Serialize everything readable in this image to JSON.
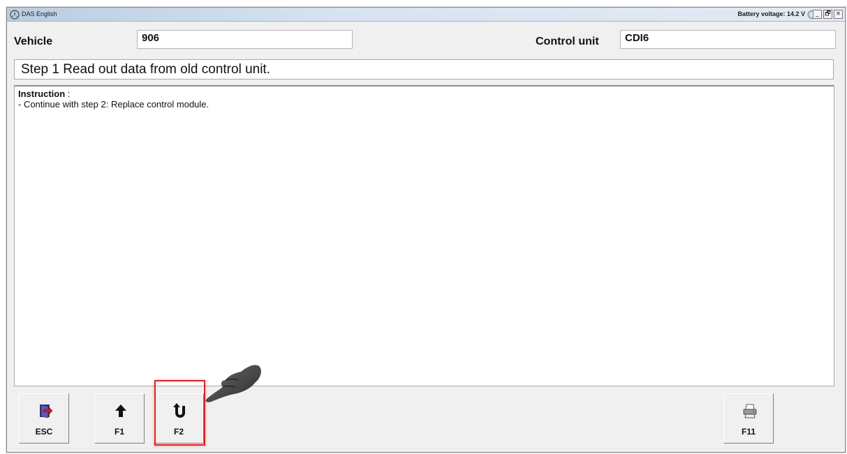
{
  "window": {
    "title": "DAS English",
    "battery_label": "Battery voltage: 14.2 V",
    "controls": {
      "minimize": "_",
      "restore": "🗗",
      "close": "×"
    }
  },
  "header": {
    "vehicle_label": "Vehicle",
    "vehicle_value": "906",
    "control_unit_label": "Control unit",
    "control_unit_value": "CDI6"
  },
  "step": {
    "text": "Step 1 Read out data from old control unit."
  },
  "instruction": {
    "heading": "Instruction",
    "separator": " :",
    "lines": [
      "- Continue with step 2: Replace control module."
    ]
  },
  "toolbar": {
    "buttons": [
      {
        "key": "ESC",
        "icon": "exit-door-icon"
      },
      {
        "key": "F1",
        "icon": "arrow-up-icon"
      },
      {
        "key": "F2",
        "icon": "u-turn-arrow-icon"
      },
      {
        "key": "F11",
        "icon": "printer-icon"
      }
    ]
  },
  "colors": {
    "highlight": "#e21f1f",
    "titlebar": "#c9d9ea",
    "background": "#f0f0f0"
  }
}
